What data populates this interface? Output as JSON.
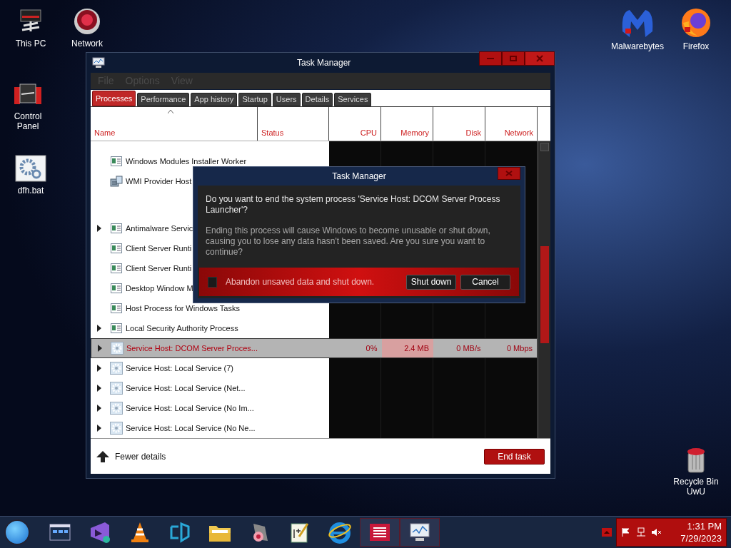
{
  "desktop_icons": [
    {
      "label": "This PC",
      "kind": "pc"
    },
    {
      "label": "Network",
      "kind": "network"
    },
    {
      "label": "Control Panel",
      "kind": "control"
    },
    {
      "label": "dfh.bat",
      "kind": "bat"
    },
    {
      "label": "Malwarebytes",
      "kind": "malwarebytes"
    },
    {
      "label": "Firefox",
      "kind": "firefox"
    },
    {
      "label": "Recycle Bin\nUwU",
      "kind": "recycle"
    }
  ],
  "window": {
    "title": "Task Manager",
    "menu": [
      "File",
      "Options",
      "View"
    ],
    "tabs": [
      {
        "label": "Processes",
        "selected": true
      },
      {
        "label": "Performance",
        "selected": false
      },
      {
        "label": "App history",
        "selected": false
      },
      {
        "label": "Startup",
        "selected": false
      },
      {
        "label": "Users",
        "selected": false
      },
      {
        "label": "Details",
        "selected": false
      },
      {
        "label": "Services",
        "selected": false
      }
    ],
    "columns": [
      "Name",
      "Status",
      "CPU",
      "Memory",
      "Disk",
      "Network"
    ],
    "groups": [
      {
        "rows": [
          {
            "name": "Windows Modules Installer Worker",
            "kind": "window",
            "expandable": false,
            "selected": false
          },
          {
            "name": "WMI Provider Host",
            "kind": "wmi",
            "expandable": false,
            "selected": false
          }
        ]
      },
      {
        "rows": [
          {
            "name": "Antimalware Servic",
            "kind": "window",
            "expandable": true,
            "selected": false
          },
          {
            "name": "Client Server Runti",
            "kind": "window",
            "expandable": false,
            "selected": false
          },
          {
            "name": "Client Server Runti",
            "kind": "window",
            "expandable": false,
            "selected": false
          },
          {
            "name": "Desktop Window M",
            "kind": "window",
            "expandable": false,
            "selected": false
          },
          {
            "name": "Host Process for Windows Tasks",
            "kind": "window",
            "expandable": false,
            "selected": false
          },
          {
            "name": "Local Security Authority Process",
            "kind": "window",
            "expandable": true,
            "selected": false
          },
          {
            "name": "Service Host: DCOM Server Proces...",
            "kind": "gear",
            "expandable": true,
            "selected": true,
            "cpu": "0%",
            "memory": "2.4 MB",
            "disk": "0 MB/s",
            "network": "0 Mbps"
          },
          {
            "name": "Service Host: Local Service (7)",
            "kind": "gear",
            "expandable": true,
            "selected": false
          },
          {
            "name": "Service Host: Local Service (Net...",
            "kind": "gear",
            "expandable": true,
            "selected": false
          },
          {
            "name": "Service Host: Local Service (No Im...",
            "kind": "gear",
            "expandable": true,
            "selected": false
          },
          {
            "name": "Service Host: Local Service (No Ne...",
            "kind": "gear",
            "expandable": true,
            "selected": false
          }
        ]
      }
    ],
    "fewer_details": "Fewer details",
    "end_task": "End task"
  },
  "dialog": {
    "title": "Task Manager",
    "question": "Do you want to end the system process 'Service Host: DCOM Server Process Launcher'?",
    "warning": "Ending this process will cause Windows to become unusable or shut down, causing you to lose any data hasn't been saved. Are you sure you want to continue?",
    "checkbox": {
      "label": "Abandon unsaved data and shut down.",
      "checked": false
    },
    "buttons": [
      "Shut down",
      "Cancel"
    ]
  },
  "taskbar": {
    "items": [
      {
        "kind": "cmd",
        "active": false
      },
      {
        "kind": "vs",
        "active": false
      },
      {
        "kind": "vlc",
        "active": false
      },
      {
        "kind": "vscode",
        "active": false
      },
      {
        "kind": "folder",
        "active": false
      },
      {
        "kind": "paint",
        "active": false
      },
      {
        "kind": "notepad",
        "active": false
      },
      {
        "kind": "ie",
        "active": false
      },
      {
        "kind": "list",
        "active": true
      },
      {
        "kind": "taskmgr",
        "active": true
      }
    ],
    "time": "1:31 PM",
    "date": "7/29/2023"
  }
}
